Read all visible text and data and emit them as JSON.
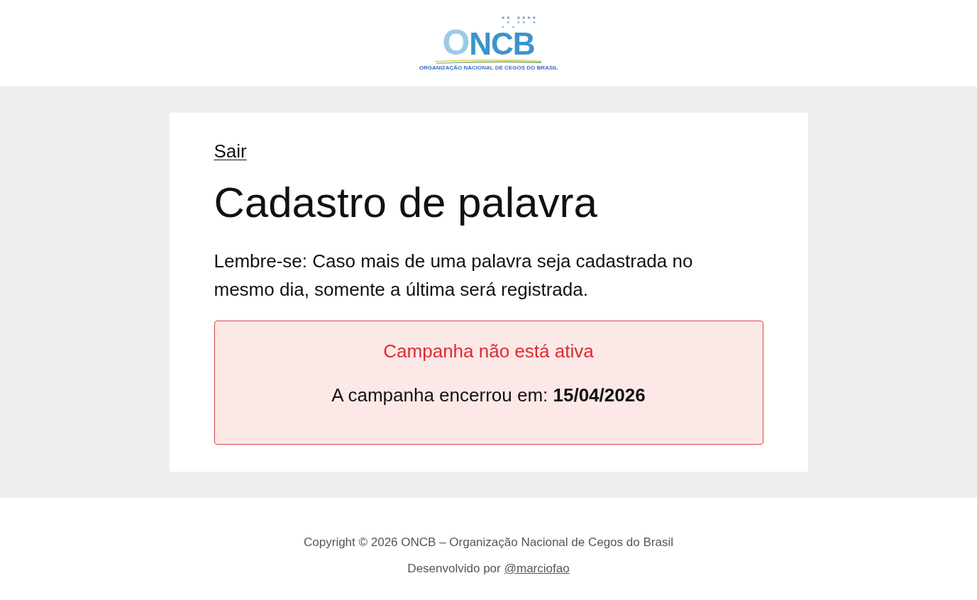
{
  "header": {
    "logo": {
      "name": "ONCB",
      "tagline": "ORGANIZAÇÃO NACIONAL DE CEGOS DO BRASIL"
    }
  },
  "card": {
    "logout_link": "Sair",
    "title": "Cadastro de palavra",
    "notice": "Lembre-se: Caso mais de uma palavra seja cadastrada no mesmo dia, somente a última será registrada.",
    "alert": {
      "kind": "error",
      "title": "Campanha não está ativa",
      "message": "A campanha encerrou em: **15/04/2026**"
    }
  },
  "footer": {
    "copyright": "Copyright © 2026 ONCB – Organização Nacional de Cegos do Brasil",
    "credit": {
      "text": "Desenvolvido por",
      "link": "@marciofao"
    }
  }
}
